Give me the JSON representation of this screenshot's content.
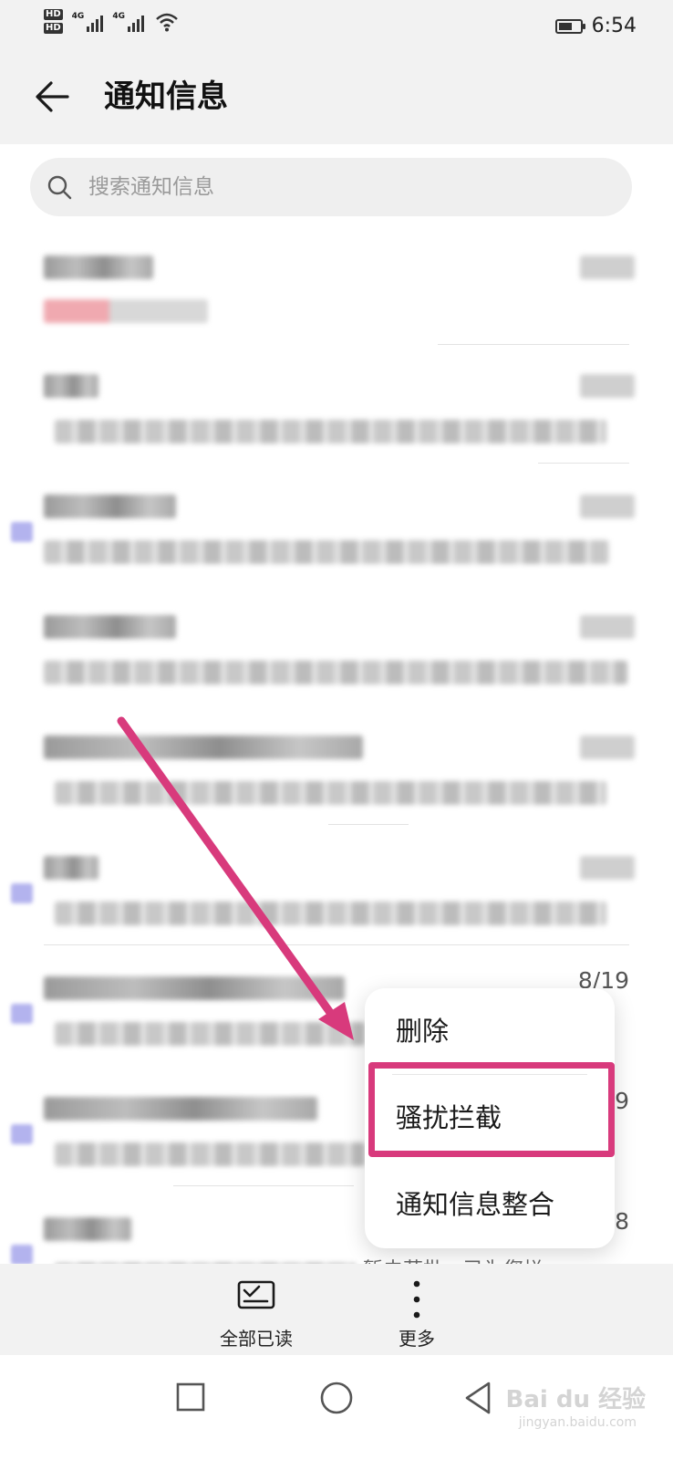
{
  "status_bar": {
    "hd1": "HD",
    "hd2": "HD",
    "net1": "4G",
    "net2": "4G",
    "time": "6:54"
  },
  "header": {
    "title": "通知信息",
    "back_icon": "arrow-left-icon"
  },
  "search": {
    "placeholder": "搜索通知信息",
    "icon": "search-icon"
  },
  "messages": [
    {
      "unread": false
    },
    {
      "unread": false
    },
    {
      "unread": true
    },
    {
      "unread": false
    },
    {
      "unread": false
    },
    {
      "unread": true
    },
    {
      "unread": true,
      "date": "8/19"
    },
    {
      "unread": true,
      "date": "9"
    },
    {
      "unread": true,
      "date": "8",
      "preview_tail": "暂未获批。已为您拦..."
    }
  ],
  "menu": {
    "items": [
      "删除",
      "骚扰拦截",
      "通知信息整合"
    ],
    "highlighted": "骚扰拦截",
    "highlight_color": "#d83a7c"
  },
  "toolbar": {
    "mark_all_read": "全部已读",
    "more": "更多"
  },
  "nav": {
    "recent_icon": "square-icon",
    "home_icon": "circle-icon",
    "back_icon": "triangle-back-icon"
  },
  "watermark": {
    "brand": "Bai du 经验",
    "url": "jingyan.baidu.com"
  }
}
